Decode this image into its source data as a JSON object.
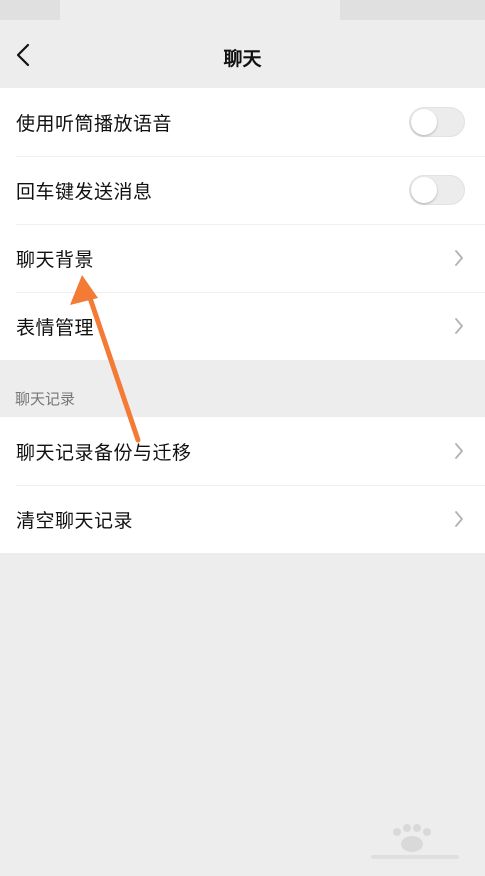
{
  "nav": {
    "title": "聊天"
  },
  "settings": {
    "items": [
      {
        "label": "使用听筒播放语音",
        "control": "toggle",
        "on": false
      },
      {
        "label": "回车键发送消息",
        "control": "toggle",
        "on": false
      },
      {
        "label": "聊天背景",
        "control": "chevron"
      },
      {
        "label": "表情管理",
        "control": "chevron"
      }
    ]
  },
  "chat_history": {
    "header": "聊天记录",
    "items": [
      {
        "label": "聊天记录备份与迁移",
        "control": "chevron"
      },
      {
        "label": "清空聊天记录",
        "control": "chevron"
      }
    ]
  },
  "annotation": {
    "arrow_color": "#f47b36"
  },
  "icons": {
    "back": "chevron-left-icon",
    "item_chevron": "chevron-right-icon"
  },
  "colors": {
    "background": "#ededed",
    "card": "#ffffff",
    "text": "#111111",
    "section_text": "#777777",
    "toggle_off": "#ececec"
  }
}
